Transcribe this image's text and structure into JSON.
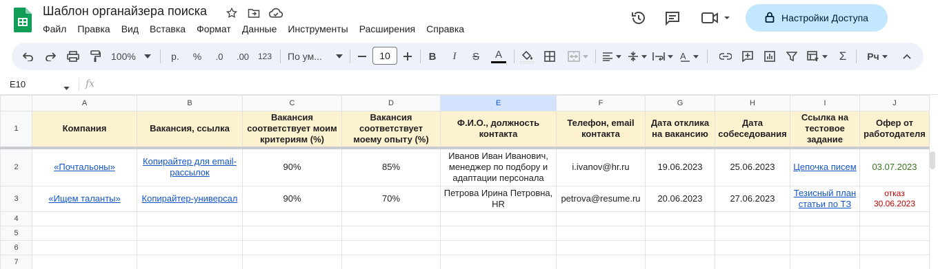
{
  "doc": {
    "title": "Шаблон органайзера поиска"
  },
  "menu": [
    "Файл",
    "Правка",
    "Вид",
    "Вставка",
    "Формат",
    "Данные",
    "Инструменты",
    "Расширения",
    "Справка"
  ],
  "share": {
    "label": "Настройки Доступа"
  },
  "toolbar": {
    "zoom": "100%",
    "currency": "р.",
    "percent": "%",
    "dec_decrease": ".0",
    "dec_increase": ".00",
    "number_format": "123",
    "font": "По ум...",
    "font_size": "10",
    "bold": "B",
    "italic": "I",
    "strike": "S",
    "text_color": "A",
    "sum": "Σ",
    "input_tools": "Рч"
  },
  "formula_bar": {
    "cell": "E10",
    "fx": "fx"
  },
  "grid": {
    "columns": [
      "A",
      "B",
      "C",
      "D",
      "E",
      "F",
      "G",
      "H",
      "I",
      "J"
    ],
    "row_numbers": [
      "1",
      "2",
      "3",
      "4",
      "5",
      "6",
      "7"
    ],
    "header": [
      "Компания",
      "Вакансия, ссылка",
      "Вакансия соответствует моим критериям (%)",
      "Вакансия соответствует моему опыту (%)",
      "Ф.И.О., должность контакта",
      "Телефон, email контакта",
      "Дата отклика на вакансию",
      "Дата собеседования",
      "Ссылка на тестовое задание",
      "Офер от работодателя"
    ],
    "rows": [
      {
        "company": "«Почтальоны»",
        "vacancy": "Копирайтер для email-рассылок",
        "criteria": "90%",
        "experience": "85%",
        "contact": "Иванов Иван Иванович, менеджер по подбору и адаптации персонала",
        "phone_email": "i.ivanov@hr.ru",
        "applied": "19.06.2023",
        "interview": "25.06.2023",
        "test_link": "Цепочка писем",
        "offer": "03.07.2023"
      },
      {
        "company": "«Ищем таланты»",
        "vacancy": "Копирайтер-универсал",
        "criteria": "90%",
        "experience": "70%",
        "contact": "Петрова Ирина Петровна, HR",
        "phone_email": "petrova@resume.ru",
        "applied": "20.06.2023",
        "interview": "27.06.2023",
        "test_link": "Тезисный план статьи по ТЗ",
        "offer_line1": "отказ",
        "offer_line2": "30.06.2023"
      }
    ]
  },
  "colors": {
    "header_fill": "#fdf2d0",
    "link": "#1155cc",
    "offer_ok": "#38761d",
    "offer_reject": "#c00000",
    "share_btn": "#c2e7ff"
  }
}
